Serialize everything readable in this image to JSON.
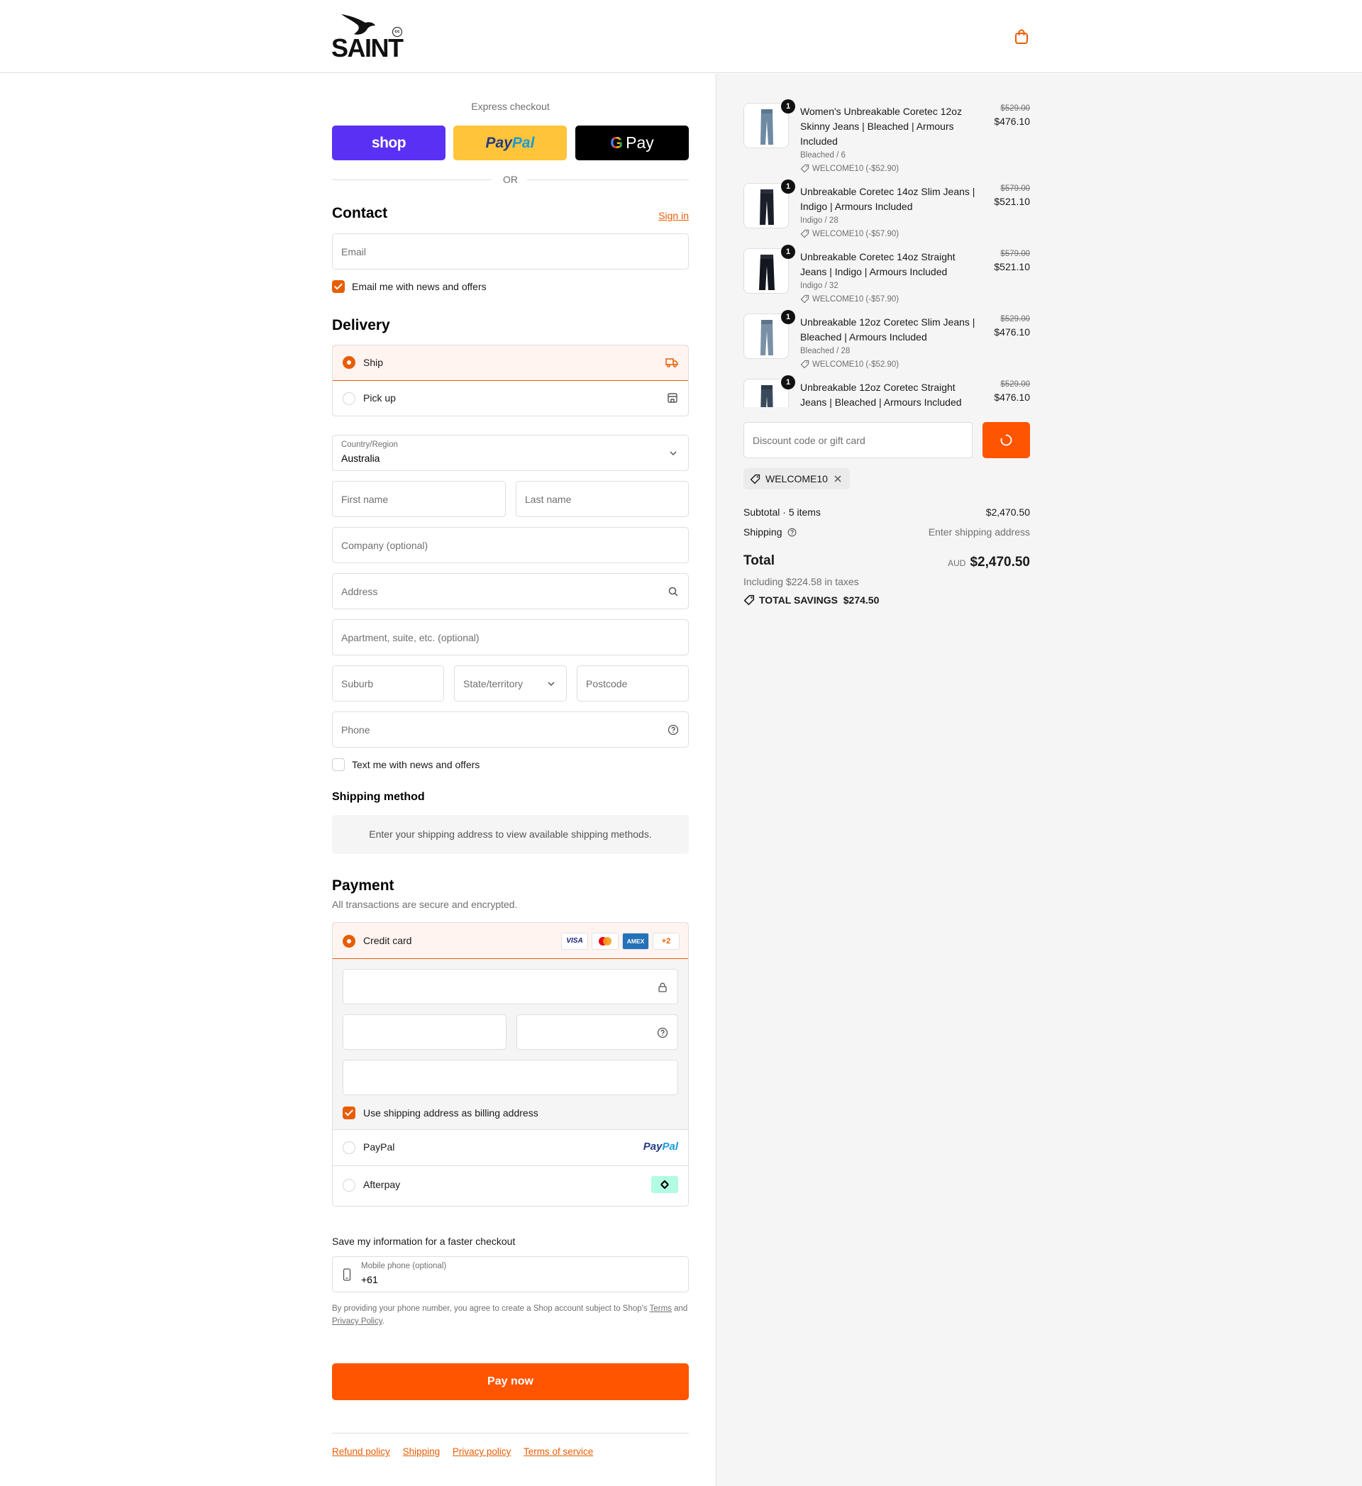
{
  "brand": {
    "name": "SAINT",
    "badge": "cc"
  },
  "express": {
    "title": "Express checkout",
    "shop_label": "shop",
    "paypal_label_a": "Pay",
    "paypal_label_b": "Pal",
    "gpay_g": "G",
    "gpay_label": "Pay",
    "or": "OR"
  },
  "contact": {
    "heading": "Contact",
    "sign_in": "Sign in",
    "email_placeholder": "Email",
    "newsletter_label": "Email me with news and offers",
    "newsletter_checked": true
  },
  "delivery": {
    "heading": "Delivery",
    "options": [
      {
        "label": "Ship",
        "selected": true,
        "icon": "truck-icon"
      },
      {
        "label": "Pick up",
        "selected": false,
        "icon": "store-icon"
      }
    ],
    "country_label": "Country/Region",
    "country_value": "Australia",
    "first_name": "First name",
    "last_name": "Last name",
    "company": "Company (optional)",
    "address": "Address",
    "apartment": "Apartment, suite, etc. (optional)",
    "suburb": "Suburb",
    "state": "State/territory",
    "postcode": "Postcode",
    "phone": "Phone",
    "sms_label": "Text me with news and offers"
  },
  "shipping_method": {
    "heading": "Shipping method",
    "notice": "Enter your shipping address to view available shipping methods."
  },
  "payment": {
    "heading": "Payment",
    "subtitle": "All transactions are secure and encrypted.",
    "credit_card_label": "Credit card",
    "card_brands": [
      "VISA",
      "mastercard",
      "AMEX",
      "+2"
    ],
    "billing_label": "Use shipping address as billing address",
    "paypal_label": "PayPal",
    "afterpay_label": "Afterpay"
  },
  "save_info": {
    "heading": "Save my information for a faster checkout",
    "mobile_label": "Mobile phone (optional)",
    "mobile_value": "+61",
    "legal_prefix": "By providing your phone number, you agree to create a Shop account subject to Shop's",
    "terms": "Terms",
    "and": "and",
    "privacy": "Privacy Policy",
    "period": "."
  },
  "pay_button": "Pay now",
  "footer_links": [
    "Refund policy",
    "Shipping",
    "Privacy policy",
    "Terms of service"
  ],
  "cart_items": [
    {
      "qty": "1",
      "name": "Women's Unbreakable Coretec 12oz Skinny Jeans | Bleached | Armours Included",
      "variant": "Bleached / 6",
      "discount": "WELCOME10 (-$52.90)",
      "old_price": "$529.00",
      "price": "$476.10"
    },
    {
      "qty": "1",
      "name": "Unbreakable Coretec 14oz Slim Jeans | Indigo | Armours Included",
      "variant": "Indigo / 28",
      "discount": "WELCOME10 (-$57.90)",
      "old_price": "$579.00",
      "price": "$521.10"
    },
    {
      "qty": "1",
      "name": "Unbreakable Coretec 14oz Straight Jeans | Indigo | Armours Included",
      "variant": "Indigo / 32",
      "discount": "WELCOME10 (-$57.90)",
      "old_price": "$579.00",
      "price": "$521.10"
    },
    {
      "qty": "1",
      "name": "Unbreakable 12oz Coretec Slim Jeans | Bleached | Armours Included",
      "variant": "Bleached / 28",
      "discount": "WELCOME10 (-$52.90)",
      "old_price": "$529.00",
      "price": "$476.10"
    },
    {
      "qty": "1",
      "name": "Unbreakable 12oz Coretec Straight Jeans | Bleached | Armours Included",
      "old_price": "$529.00",
      "price": "$476.10"
    }
  ],
  "discount": {
    "placeholder": "Discount code or gift card",
    "applied_code": "WELCOME10"
  },
  "totals": {
    "subtotal_label": "Subtotal · 5 items",
    "subtotal_value": "$2,470.50",
    "shipping_label": "Shipping",
    "shipping_value": "Enter shipping address",
    "total_label": "Total",
    "currency": "AUD",
    "total_value": "$2,470.50",
    "taxes": "Including $224.58 in taxes",
    "savings_label": "TOTAL SAVINGS",
    "savings_value": "$274.50"
  },
  "colors": {
    "accent": "#e85d04",
    "pay_button": "#ff5500",
    "shop": "#5a31f4",
    "paypal": "#ffc439"
  }
}
